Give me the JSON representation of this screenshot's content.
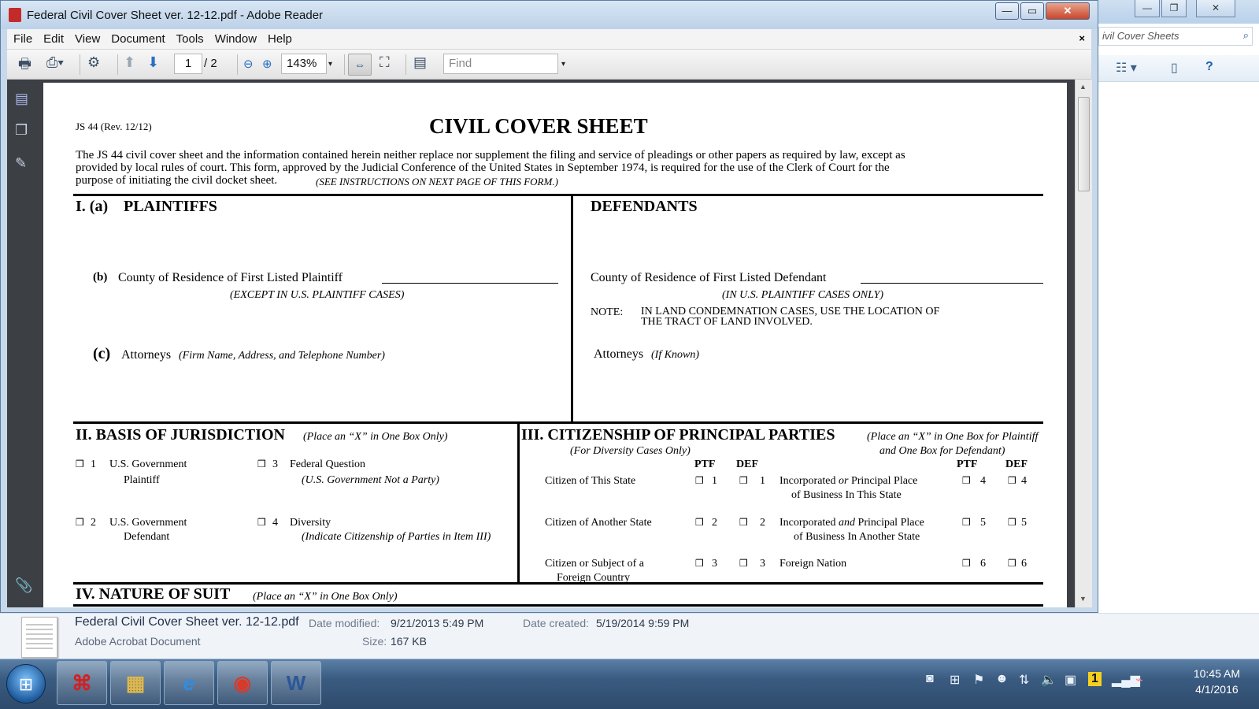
{
  "window": {
    "title": "Federal Civil Cover Sheet ver. 12-12.pdf - Adobe Reader",
    "min_label": "—",
    "max_label": "▭",
    "close_label": "✕"
  },
  "menu": {
    "items": [
      "File",
      "Edit",
      "View",
      "Document",
      "Tools",
      "Window",
      "Help"
    ],
    "close": "×"
  },
  "toolbar": {
    "page_current": "1",
    "page_total": "/ 2",
    "zoom": "143%",
    "find_placeholder": "Find"
  },
  "background_window": {
    "search_text": "ivil Cover Sheets"
  },
  "document": {
    "form_id": "JS 44   (Rev. 12/12)",
    "title": "CIVIL COVER SHEET",
    "intro_line1": "The JS 44 civil cover sheet and the information contained herein neither replace nor supplement the filing and service of pleadings or other papers as required by law,  except as",
    "intro_line2": "provided by local rules of court.  This form, approved by the Judicial Conference of the United States in September 1974, is required for the use of the Clerk of Court for the",
    "intro_line3": "purpose of initiating the civil docket sheet.",
    "intro_note": "(SEE INSTRUCTIONS ON NEXT PAGE OF THIS FORM.)",
    "section1": {
      "heading_num": "I. (a)",
      "plaintiffs": "PLAINTIFFS",
      "defendants": "DEFENDANTS",
      "b_label": "(b)",
      "county_plaintiff": "County of Residence of First Listed Plaintiff",
      "except_note": "(EXCEPT IN U.S. PLAINTIFF CASES)",
      "county_defendant": "County of Residence of First Listed Defendant",
      "in_us_note": "(IN U.S. PLAINTIFF CASES ONLY)",
      "note_label": "NOTE:",
      "note_line1": "IN LAND CONDEMNATION CASES, USE THE LOCATION OF",
      "note_line2": "THE TRACT OF LAND INVOLVED.",
      "c_label": "(c)",
      "attorneys": "Attorneys",
      "attorneys_note": "(Firm Name, Address, and Telephone Number)",
      "attorneys_def": "Attorneys",
      "attorneys_def_note": "(If Known)"
    },
    "section2": {
      "heading": "II.  BASIS OF JURISDICTION",
      "note": "(Place an “X” in One Box Only)",
      "opt1_num": "1",
      "opt1_l1": "U.S. Government",
      "opt1_l2": "Plaintiff",
      "opt3_num": "3",
      "opt3_l1": "Federal Question",
      "opt3_l2": "(U.S. Government Not a Party)",
      "opt2_num": "2",
      "opt2_l1": "U.S. Government",
      "opt2_l2": "Defendant",
      "opt4_num": "4",
      "opt4_l1": "Diversity",
      "opt4_l2": "(Indicate Citizenship of Parties in Item III)"
    },
    "section3": {
      "heading": "III.  CITIZENSHIP OF PRINCIPAL PARTIES",
      "note1": "(Place an “X” in One Box for Plaintiff",
      "diversity": "(For Diversity Cases Only)",
      "note2": "and One Box for Defendant)",
      "ptf": "PTF",
      "def": "DEF",
      "row1_label": "Citizen of This State",
      "row1_ptf": "1",
      "row1_def": "1",
      "row1_inc1_a": "Incorporated",
      "row1_inc1_or": "or",
      "row1_inc1_b": "Principal Place",
      "row1_inc2": "of Business In This State",
      "row1_ptf2": "4",
      "row1_def2": "4",
      "row2_label": "Citizen of Another State",
      "row2_ptf": "2",
      "row2_def": "2",
      "row2_inc1_a": "Incorporated",
      "row2_inc1_and": "and",
      "row2_inc1_b": "Principal Place",
      "row2_inc2": "of Business In Another State",
      "row2_ptf2": "5",
      "row2_def2": "5",
      "row3_label1": "Citizen or Subject of a",
      "row3_label2": "Foreign Country",
      "row3_ptf": "3",
      "row3_def": "3",
      "row3_inc": "Foreign Nation",
      "row3_ptf2": "6",
      "row3_def2": "6"
    },
    "section4": {
      "heading": "IV.  NATURE OF SUIT",
      "note": "(Place an “X” in One Box Only)"
    }
  },
  "details": {
    "file_name": "Federal Civil Cover Sheet ver. 12-12.pdf",
    "file_type": "Adobe Acrobat Document",
    "modified_label": "Date modified:",
    "modified_value": "9/21/2013 5:49 PM",
    "created_label": "Date created:",
    "created_value": "5/19/2014 9:59 PM",
    "size_label": "Size:",
    "size_value": "167 KB"
  },
  "taskbar": {
    "time": "10:45 AM",
    "date": "4/1/2016",
    "word_label": "W",
    "tray_badge": "1"
  },
  "colors": {
    "titlebar": "#bcd1e8",
    "taskbar": "#3a5b80",
    "reader_nav": "#3c3f44",
    "pdf_red": "#c42a2a"
  }
}
